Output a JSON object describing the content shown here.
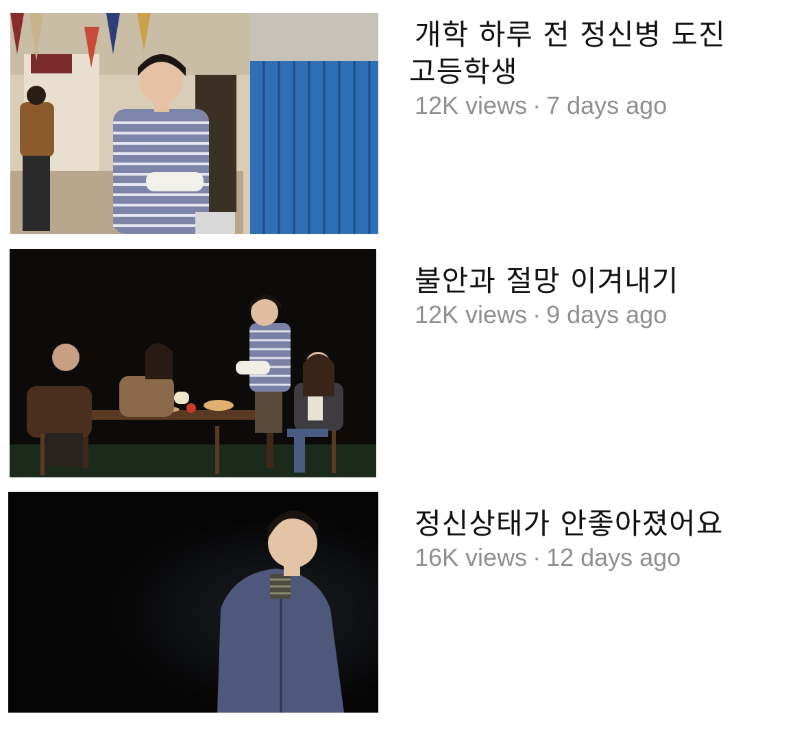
{
  "videos": [
    {
      "thumbnail": "school-hallway-student-in-striped-shirt-with-arm-cast",
      "title_line1": "개학 하루 전 정신병 도진",
      "title_line2": "고등학생",
      "views": "12K views",
      "separator": "·",
      "age": "7 days ago"
    },
    {
      "thumbnail": "stage-family-dinner-table-scene",
      "title": "불안과 절망 이겨내기",
      "views": "12K views",
      "separator": "·",
      "age": "9 days ago"
    },
    {
      "thumbnail": "stage-performer-in-grey-hoodie-spotlight",
      "title": "정신상태가 안좋아졌어요",
      "views": "16K views",
      "separator": "·",
      "age": "12 days ago"
    }
  ],
  "colors": {
    "background": "#ffffff",
    "title": "#111111",
    "stats": "#8f8f8f",
    "locker_blue": "#2f6fb8"
  }
}
